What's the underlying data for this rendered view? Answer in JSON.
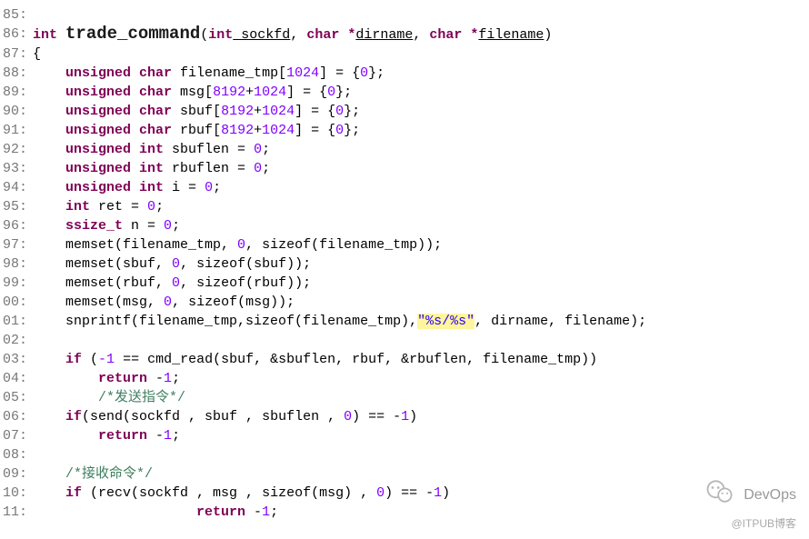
{
  "watermark": {
    "label": "DevOps",
    "footer": "@ITPUB博客"
  },
  "gutter": [
    "85:",
    "86:",
    "87:",
    "88:",
    "89:",
    "90:",
    "91:",
    "92:",
    "93:",
    "94:",
    "95:",
    "96:",
    "97:",
    "98:",
    "99:",
    "00:",
    "01:",
    "02:",
    "03:",
    "04:",
    "05:",
    "06:",
    "07:",
    "08:",
    "09:",
    "10:",
    "11:"
  ],
  "code": {
    "fn_return": "int",
    "fn_name": "trade_command",
    "fn_sig_open": "(",
    "fn_p1_type": "int",
    "fn_p1_name": " sockfd",
    "comma": ", ",
    "fn_p2_type": "char *",
    "fn_p2_name": "dirname",
    "fn_p3_type": "char *",
    "fn_p3_name": "filename",
    "fn_sig_close": ")",
    "brace_open": "{",
    "brace_close": "}",
    "indent1": "    ",
    "indent2": "        ",
    "indent3": "            ",
    "indent15": "                    ",
    "decl_uc": "unsigned char",
    "decl_ui": "unsigned int",
    "decl_int": "int",
    "decl_ssize": "ssize_t",
    "v_filename_tmp": " filename_tmp",
    "v_msg": " msg",
    "v_sbuf": " sbuf",
    "v_rbuf": " rbuf",
    "v_sbuflen": " sbuflen = ",
    "v_rbuflen": " rbuflen = ",
    "v_i": " i = ",
    "v_ret": " ret = ",
    "v_n": " n = ",
    "arr_open": "[",
    "arr_close": "]",
    "n1024": "1024",
    "n8192": "8192",
    "plus": "+",
    "init_zero_arr": " = {",
    "n0": "0",
    "neg1": "-1",
    "init_close": "};",
    "semi": ";",
    "memset1": "memset(filename_tmp, ",
    "memset1b": ", sizeof(filename_tmp));",
    "memset2": "memset(sbuf, ",
    "memset2b": ", sizeof(sbuf));",
    "memset3": "memset(rbuf, ",
    "memset3b": ", sizeof(rbuf));",
    "memset4": "memset(msg, ",
    "memset4b": ", sizeof(msg));",
    "snprintf_a": "snprintf(filename_tmp,sizeof(filename_tmp),",
    "snprintf_fmt": "\"%s/%s\"",
    "snprintf_b": ", dirname, filename);",
    "kw_if": "if",
    "if1_open": " (",
    "if1_eq": " == cmd_read(sbuf, &sbuflen, rbuf, &rbuflen, filename_tmp))",
    "kw_return": "return",
    "ret_neg1": " -",
    "cmt_send": "/*发送指令*/",
    "if2_open": "(send(sockfd , sbuf , sbuflen , ",
    "if2_close": ") == -",
    "if_paren_close": ")",
    "cmt_recv": "/*接收命令*/",
    "if3_open": " (recv(sockfd , msg , sizeof(msg) , ",
    "if3_close": ") == -",
    "one": "1",
    "one_semi": ";"
  }
}
